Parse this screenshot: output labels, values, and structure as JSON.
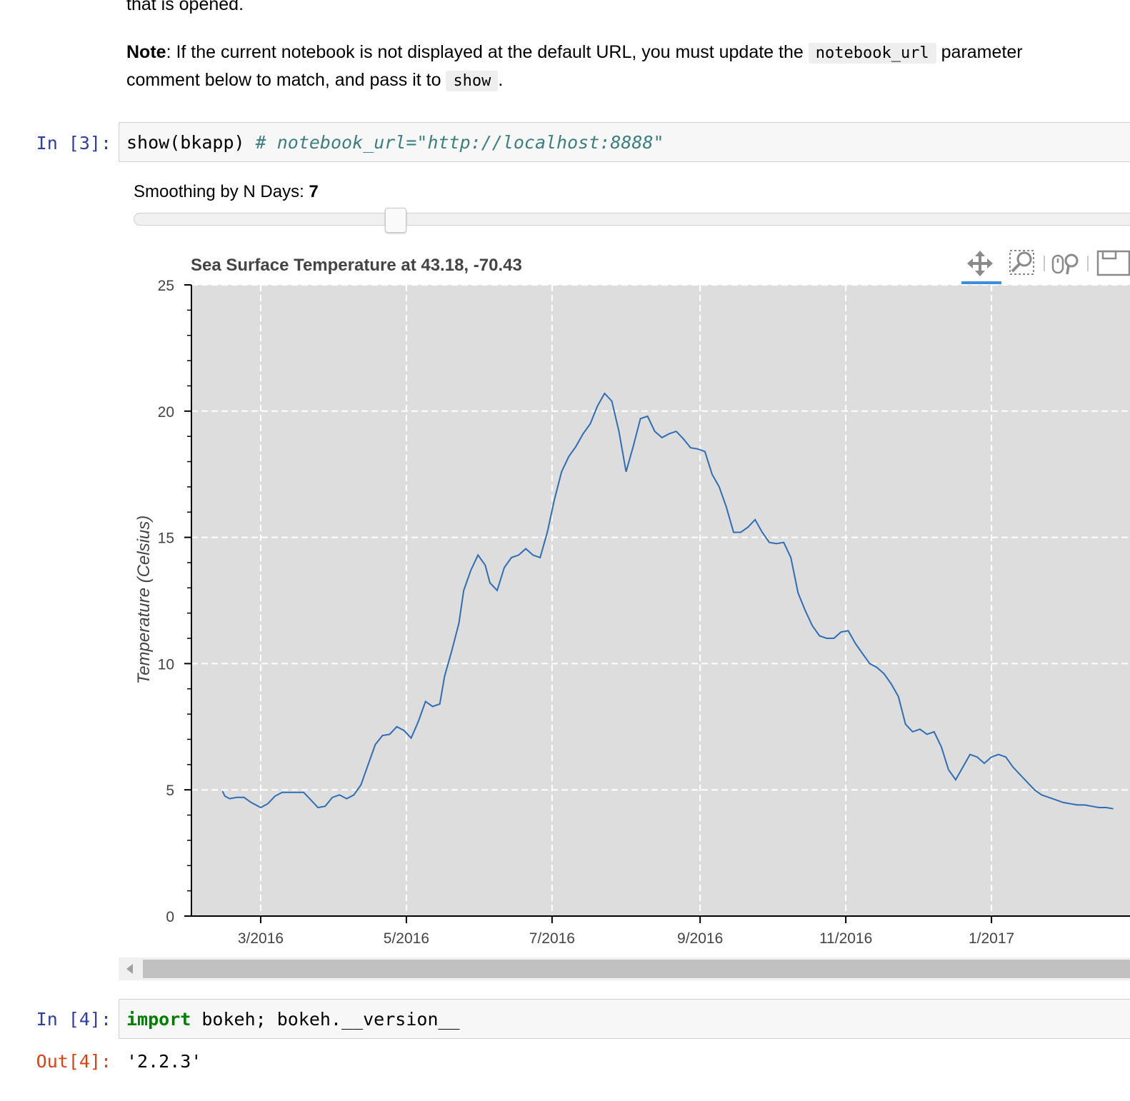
{
  "markdown": {
    "line0": "that is opened.",
    "note_bold": "Note",
    "note_text1": ": If the current notebook is not displayed at the default URL, you must update the ",
    "note_code1": "notebook_url",
    "note_text2": " parameter",
    "note_text3": "comment below to match, and pass it to ",
    "note_code2": "show",
    "note_text4": "."
  },
  "cells": [
    {
      "prompt": "In [3]:",
      "code": "show(bkapp) ",
      "comment": "# notebook_url=\"http://localhost:8888\""
    },
    {
      "prompt": "In [4]:",
      "keyword": "import",
      "code": " bokeh; bokeh.__version__"
    }
  ],
  "output": {
    "prompt": "Out[4]:",
    "value": "'2.2.3'"
  },
  "slider": {
    "label": "Smoothing by N Days: ",
    "value": "7"
  },
  "toolbar": {
    "tools": [
      "pan-icon",
      "box-zoom-icon",
      "wheel-zoom-icon",
      "save-icon"
    ],
    "active": "pan-icon",
    "active_color": "#3b8fdb"
  },
  "chart_data": {
    "type": "line",
    "title": "Sea Surface Temperature at 43.18, -70.43",
    "xlabel": "",
    "ylabel": "Temperature (Celsius)",
    "ylim": [
      0,
      25
    ],
    "yticks": [
      0,
      5,
      10,
      15,
      20,
      25
    ],
    "xticks": [
      "2016-03-01",
      "2016-05-01",
      "2016-07-01",
      "2016-09-01",
      "2016-11-01",
      "2017-01-01"
    ],
    "xtick_labels": [
      "3/2016",
      "5/2016",
      "7/2016",
      "9/2016",
      "11/2016",
      "1/2017"
    ],
    "grid": true,
    "background": "#dddddd",
    "line_color": "#2f6db5",
    "series": [
      {
        "x": [
          "2016-02-14",
          "2016-02-15",
          "2016-02-17",
          "2016-02-20",
          "2016-02-23",
          "2016-02-26",
          "2016-03-01",
          "2016-03-04",
          "2016-03-07",
          "2016-03-10",
          "2016-03-13",
          "2016-03-16",
          "2016-03-19",
          "2016-03-22",
          "2016-03-25",
          "2016-03-28",
          "2016-03-31",
          "2016-04-03",
          "2016-04-06",
          "2016-04-09",
          "2016-04-12",
          "2016-04-15",
          "2016-04-18",
          "2016-04-21",
          "2016-04-24",
          "2016-04-27",
          "2016-04-30",
          "2016-05-03",
          "2016-05-06",
          "2016-05-09",
          "2016-05-12",
          "2016-05-15",
          "2016-05-17",
          "2016-05-20",
          "2016-05-23",
          "2016-05-25",
          "2016-05-28",
          "2016-05-31",
          "2016-06-03",
          "2016-06-05",
          "2016-06-08",
          "2016-06-11",
          "2016-06-14",
          "2016-06-17",
          "2016-06-20",
          "2016-06-23",
          "2016-06-26",
          "2016-06-29",
          "2016-07-02",
          "2016-07-05",
          "2016-07-08",
          "2016-07-11",
          "2016-07-14",
          "2016-07-17",
          "2016-07-20",
          "2016-07-23",
          "2016-07-26",
          "2016-07-29",
          "2016-08-01",
          "2016-08-04",
          "2016-08-07",
          "2016-08-10",
          "2016-08-13",
          "2016-08-16",
          "2016-08-19",
          "2016-08-22",
          "2016-08-25",
          "2016-08-28",
          "2016-08-31",
          "2016-09-03",
          "2016-09-06",
          "2016-09-09",
          "2016-09-12",
          "2016-09-15",
          "2016-09-18",
          "2016-09-21",
          "2016-09-24",
          "2016-09-27",
          "2016-09-30",
          "2016-10-03",
          "2016-10-06",
          "2016-10-09",
          "2016-10-12",
          "2016-10-15",
          "2016-10-18",
          "2016-10-21",
          "2016-10-24",
          "2016-10-27",
          "2016-10-30",
          "2016-11-02",
          "2016-11-05",
          "2016-11-08",
          "2016-11-11",
          "2016-11-14",
          "2016-11-17",
          "2016-11-20",
          "2016-11-23",
          "2016-11-26",
          "2016-11-29",
          "2016-12-02",
          "2016-12-05",
          "2016-12-08",
          "2016-12-11",
          "2016-12-14",
          "2016-12-17",
          "2016-12-20",
          "2016-12-23",
          "2016-12-26",
          "2016-12-29",
          "2017-01-01",
          "2017-01-04",
          "2017-01-07",
          "2017-01-10",
          "2017-01-13",
          "2017-01-16",
          "2017-01-19",
          "2017-01-22",
          "2017-01-25",
          "2017-01-28",
          "2017-01-31",
          "2017-02-03",
          "2017-02-06",
          "2017-02-09",
          "2017-02-12",
          "2017-02-15",
          "2017-02-18",
          "2017-02-21"
        ],
        "y": [
          4.95,
          4.75,
          4.65,
          4.7,
          4.7,
          4.5,
          4.3,
          4.45,
          4.75,
          4.9,
          4.9,
          4.9,
          4.9,
          4.6,
          4.3,
          4.35,
          4.7,
          4.8,
          4.65,
          4.8,
          5.2,
          6.0,
          6.8,
          7.15,
          7.2,
          7.5,
          7.35,
          7.05,
          7.7,
          8.5,
          8.3,
          8.4,
          9.5,
          10.5,
          11.6,
          12.9,
          13.7,
          14.3,
          13.9,
          13.2,
          12.9,
          13.8,
          14.2,
          14.3,
          14.55,
          14.3,
          14.2,
          15.2,
          16.5,
          17.6,
          18.2,
          18.6,
          19.1,
          19.5,
          20.2,
          20.7,
          20.4,
          19.2,
          17.6,
          18.6,
          19.7,
          19.8,
          19.2,
          18.95,
          19.1,
          19.2,
          18.9,
          18.55,
          18.5,
          18.4,
          17.5,
          17.0,
          16.2,
          15.2,
          15.2,
          15.4,
          15.7,
          15.2,
          14.8,
          14.75,
          14.8,
          14.2,
          12.8,
          12.1,
          11.5,
          11.1,
          11.0,
          11.0,
          11.25,
          11.3,
          10.8,
          10.4,
          10.0,
          9.85,
          9.6,
          9.2,
          8.7,
          7.6,
          7.3,
          7.4,
          7.2,
          7.3,
          6.7,
          5.8,
          5.4,
          5.9,
          6.4,
          6.3,
          6.05,
          6.3,
          6.4,
          6.3,
          5.9,
          5.6,
          5.3,
          5.0,
          4.8,
          4.7,
          4.6,
          4.5,
          4.45,
          4.4,
          4.4,
          4.35,
          4.3,
          4.3,
          4.25
        ]
      }
    ]
  }
}
